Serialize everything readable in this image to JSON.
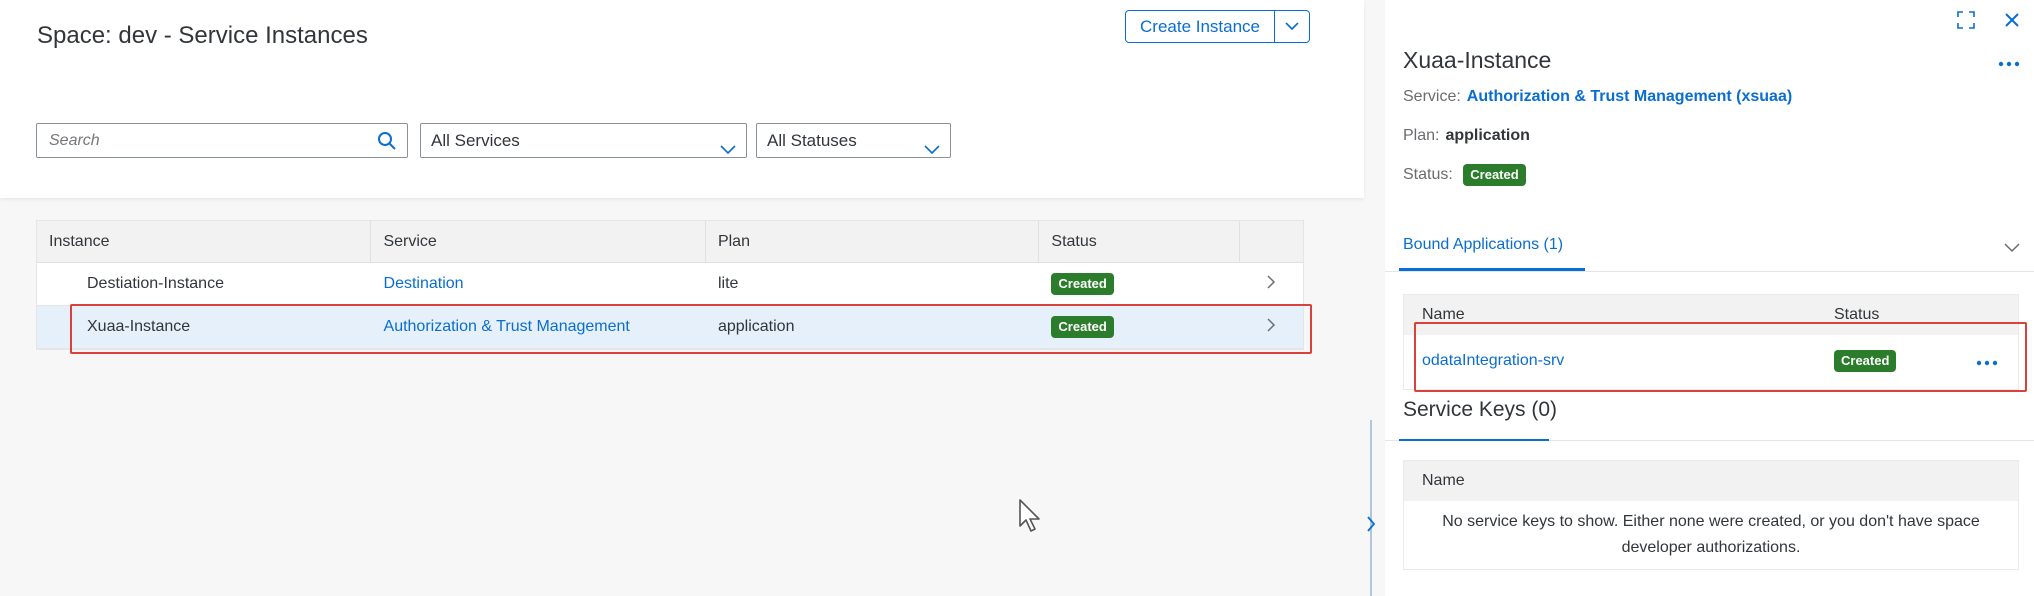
{
  "header": {
    "title": "Space: dev - Service Instances",
    "create_button": "Create Instance"
  },
  "filters": {
    "search_placeholder": "Search",
    "services_select": "All Services",
    "status_select": "All Statuses"
  },
  "table": {
    "columns": [
      "Instance",
      "Service",
      "Plan",
      "Status"
    ],
    "rows": [
      {
        "instance": "Destiation-Instance",
        "service": "Destination",
        "plan": "lite",
        "status": "Created"
      },
      {
        "instance": "Xuaa-Instance",
        "service": "Authorization & Trust Management",
        "plan": "application",
        "status": "Created"
      }
    ]
  },
  "panel": {
    "title": "Xuaa-Instance",
    "service_label": "Service:",
    "service_value": "Authorization & Trust Management (xsuaa)",
    "plan_label": "Plan:",
    "plan_value": "application",
    "status_label": "Status:",
    "status_value": "Created",
    "bound_tab": "Bound Applications (1)",
    "bound_columns": [
      "Name",
      "Status"
    ],
    "bound_rows": [
      {
        "name": "odataIntegration-srv",
        "status": "Created"
      }
    ],
    "keys_title": "Service Keys (0)",
    "keys_columns": [
      "Name"
    ],
    "keys_empty": "No service keys to show. Either none were created, or you don't have space developer authorizations."
  },
  "colors": {
    "accent": "#0a6ed1",
    "success": "#2b7d2b",
    "highlight": "#d9413b"
  }
}
